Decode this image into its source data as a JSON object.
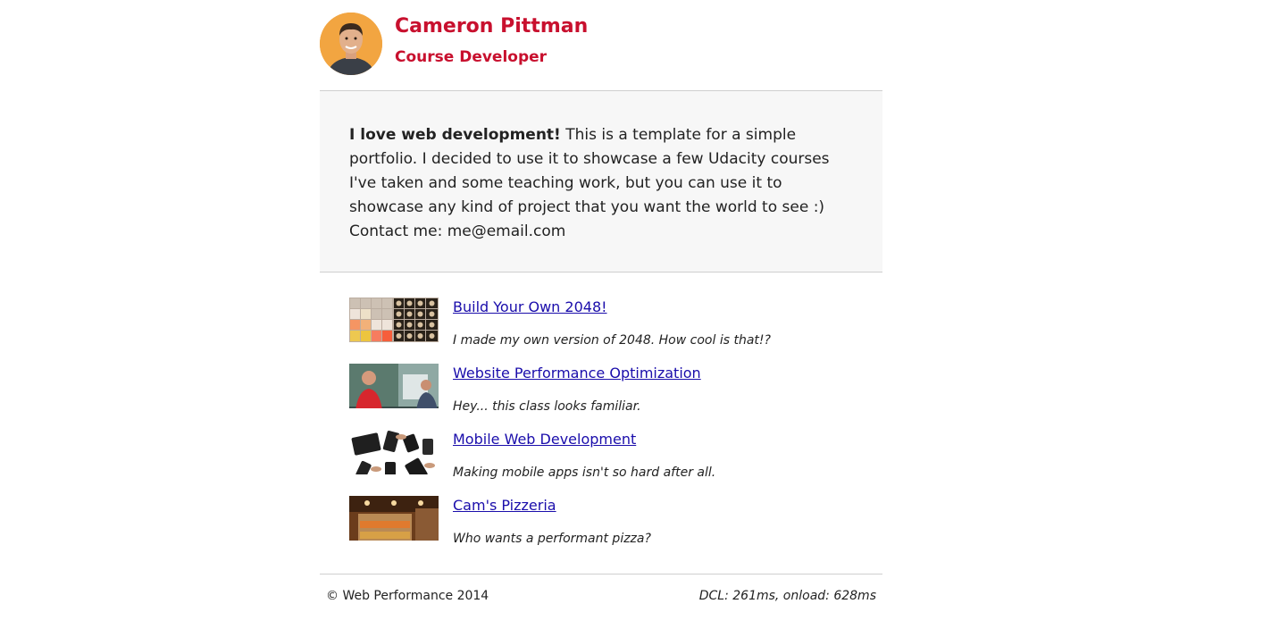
{
  "header": {
    "name": "Cameron Pittman",
    "role": "Course Developer",
    "avatar_icon": "profile-photo"
  },
  "about": {
    "bold_intro": "I love web development!",
    "text": " This is a template for a simple portfolio. I decided to use it to showcase a few Udacity courses I've taken and some teaching work, but you can use it to showcase any kind of project that you want the world to see :)",
    "contact": "Contact me: me@email.com"
  },
  "projects": [
    {
      "title": "Build Your Own 2048!",
      "description": "I made my own version of 2048. How cool is that!?"
    },
    {
      "title": "Website Performance Optimization",
      "description": "Hey... this class looks familiar."
    },
    {
      "title": "Mobile Web Development",
      "description": "Making mobile apps isn't so hard after all."
    },
    {
      "title": "Cam's Pizzeria",
      "description": "Who wants a performant pizza?"
    }
  ],
  "footer": {
    "copyright": "© Web Performance 2014",
    "perf": "DCL: 261ms, onload: 628ms"
  },
  "colors": {
    "accent": "#c8102e",
    "link": "#1a0dab",
    "about_bg": "#f7f7f7"
  }
}
